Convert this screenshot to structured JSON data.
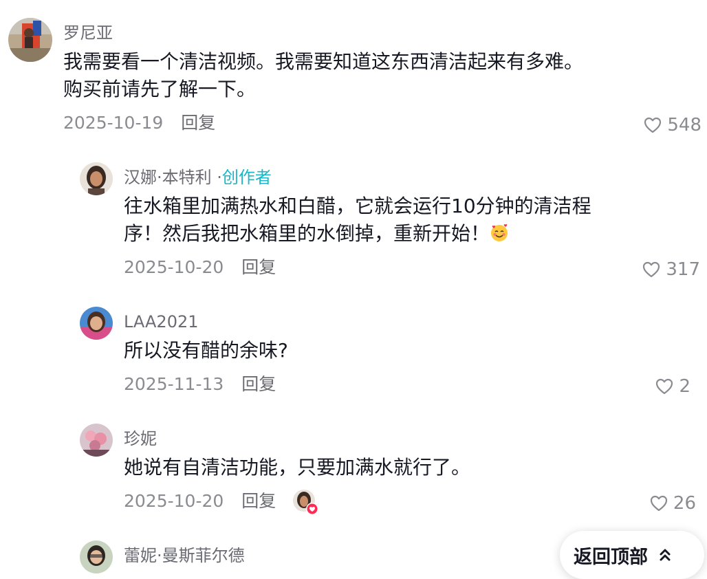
{
  "comments": [
    {
      "name": "罗尼亚",
      "text_line1": "我需要看一个清洁视频。我需要知道这东西清洁起来有多难。",
      "text_line2": "购买前请先了解一下。",
      "date": "2025-10-19",
      "reply_label": "回复",
      "likes": "548"
    },
    {
      "name": "汉娜·本特利 ·",
      "badge": "创作者",
      "text_line1": "往水箱里加满热水和白醋，它就会运行10分钟的清洁程",
      "text_line2": "序！然后我把水箱里的水倒掉，重新开始！",
      "date": "2025-10-20",
      "reply_label": "回复",
      "likes": "317"
    },
    {
      "name": "LAA2021",
      "text_line1": "所以没有醋的余味?",
      "date": "2025-11-13",
      "reply_label": "回复",
      "likes": "2"
    },
    {
      "name": "珍妮",
      "text_line1": "她说有自清洁功能，只要加满水就行了。",
      "date": "2025-10-20",
      "reply_label": "回复",
      "likes": "26"
    },
    {
      "name": "蕾妮·曼斯菲尔德"
    }
  ],
  "back_to_top": "返回顶部",
  "colors": {
    "creator_badge": "#18b8c8",
    "heart_badge": "#fe2c55",
    "meta_gray": "#8a8b91"
  }
}
